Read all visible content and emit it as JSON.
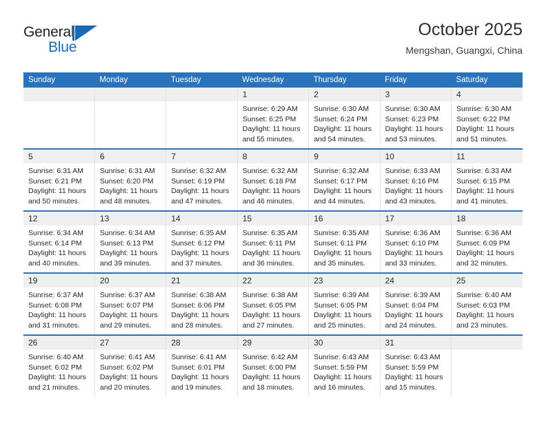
{
  "brand": {
    "name_part1": "General",
    "name_part2": "Blue",
    "flag_color": "#1c69b3",
    "logo_icon": "general-blue-flag-logo"
  },
  "header": {
    "title": "October 2025",
    "subtitle": "Mengshan, Guangxi, China",
    "accent_color": "#2a73bb"
  },
  "calendar": {
    "weekday_headers": [
      "Sunday",
      "Monday",
      "Tuesday",
      "Wednesday",
      "Thursday",
      "Friday",
      "Saturday"
    ],
    "weeks": [
      [
        {
          "day": "",
          "empty": true
        },
        {
          "day": "",
          "empty": true
        },
        {
          "day": "",
          "empty": true
        },
        {
          "day": "1",
          "sunrise": "Sunrise: 6:29 AM",
          "sunset": "Sunset: 6:25 PM",
          "daylight": "Daylight: 11 hours and 55 minutes."
        },
        {
          "day": "2",
          "sunrise": "Sunrise: 6:30 AM",
          "sunset": "Sunset: 6:24 PM",
          "daylight": "Daylight: 11 hours and 54 minutes."
        },
        {
          "day": "3",
          "sunrise": "Sunrise: 6:30 AM",
          "sunset": "Sunset: 6:23 PM",
          "daylight": "Daylight: 11 hours and 53 minutes."
        },
        {
          "day": "4",
          "sunrise": "Sunrise: 6:30 AM",
          "sunset": "Sunset: 6:22 PM",
          "daylight": "Daylight: 11 hours and 51 minutes."
        }
      ],
      [
        {
          "day": "5",
          "sunrise": "Sunrise: 6:31 AM",
          "sunset": "Sunset: 6:21 PM",
          "daylight": "Daylight: 11 hours and 50 minutes."
        },
        {
          "day": "6",
          "sunrise": "Sunrise: 6:31 AM",
          "sunset": "Sunset: 6:20 PM",
          "daylight": "Daylight: 11 hours and 48 minutes."
        },
        {
          "day": "7",
          "sunrise": "Sunrise: 6:32 AM",
          "sunset": "Sunset: 6:19 PM",
          "daylight": "Daylight: 11 hours and 47 minutes."
        },
        {
          "day": "8",
          "sunrise": "Sunrise: 6:32 AM",
          "sunset": "Sunset: 6:18 PM",
          "daylight": "Daylight: 11 hours and 46 minutes."
        },
        {
          "day": "9",
          "sunrise": "Sunrise: 6:32 AM",
          "sunset": "Sunset: 6:17 PM",
          "daylight": "Daylight: 11 hours and 44 minutes."
        },
        {
          "day": "10",
          "sunrise": "Sunrise: 6:33 AM",
          "sunset": "Sunset: 6:16 PM",
          "daylight": "Daylight: 11 hours and 43 minutes."
        },
        {
          "day": "11",
          "sunrise": "Sunrise: 6:33 AM",
          "sunset": "Sunset: 6:15 PM",
          "daylight": "Daylight: 11 hours and 41 minutes."
        }
      ],
      [
        {
          "day": "12",
          "sunrise": "Sunrise: 6:34 AM",
          "sunset": "Sunset: 6:14 PM",
          "daylight": "Daylight: 11 hours and 40 minutes."
        },
        {
          "day": "13",
          "sunrise": "Sunrise: 6:34 AM",
          "sunset": "Sunset: 6:13 PM",
          "daylight": "Daylight: 11 hours and 39 minutes."
        },
        {
          "day": "14",
          "sunrise": "Sunrise: 6:35 AM",
          "sunset": "Sunset: 6:12 PM",
          "daylight": "Daylight: 11 hours and 37 minutes."
        },
        {
          "day": "15",
          "sunrise": "Sunrise: 6:35 AM",
          "sunset": "Sunset: 6:11 PM",
          "daylight": "Daylight: 11 hours and 36 minutes."
        },
        {
          "day": "16",
          "sunrise": "Sunrise: 6:35 AM",
          "sunset": "Sunset: 6:11 PM",
          "daylight": "Daylight: 11 hours and 35 minutes."
        },
        {
          "day": "17",
          "sunrise": "Sunrise: 6:36 AM",
          "sunset": "Sunset: 6:10 PM",
          "daylight": "Daylight: 11 hours and 33 minutes."
        },
        {
          "day": "18",
          "sunrise": "Sunrise: 6:36 AM",
          "sunset": "Sunset: 6:09 PM",
          "daylight": "Daylight: 11 hours and 32 minutes."
        }
      ],
      [
        {
          "day": "19",
          "sunrise": "Sunrise: 6:37 AM",
          "sunset": "Sunset: 6:08 PM",
          "daylight": "Daylight: 11 hours and 31 minutes."
        },
        {
          "day": "20",
          "sunrise": "Sunrise: 6:37 AM",
          "sunset": "Sunset: 6:07 PM",
          "daylight": "Daylight: 11 hours and 29 minutes."
        },
        {
          "day": "21",
          "sunrise": "Sunrise: 6:38 AM",
          "sunset": "Sunset: 6:06 PM",
          "daylight": "Daylight: 11 hours and 28 minutes."
        },
        {
          "day": "22",
          "sunrise": "Sunrise: 6:38 AM",
          "sunset": "Sunset: 6:05 PM",
          "daylight": "Daylight: 11 hours and 27 minutes."
        },
        {
          "day": "23",
          "sunrise": "Sunrise: 6:39 AM",
          "sunset": "Sunset: 6:05 PM",
          "daylight": "Daylight: 11 hours and 25 minutes."
        },
        {
          "day": "24",
          "sunrise": "Sunrise: 6:39 AM",
          "sunset": "Sunset: 6:04 PM",
          "daylight": "Daylight: 11 hours and 24 minutes."
        },
        {
          "day": "25",
          "sunrise": "Sunrise: 6:40 AM",
          "sunset": "Sunset: 6:03 PM",
          "daylight": "Daylight: 11 hours and 23 minutes."
        }
      ],
      [
        {
          "day": "26",
          "sunrise": "Sunrise: 6:40 AM",
          "sunset": "Sunset: 6:02 PM",
          "daylight": "Daylight: 11 hours and 21 minutes."
        },
        {
          "day": "27",
          "sunrise": "Sunrise: 6:41 AM",
          "sunset": "Sunset: 6:02 PM",
          "daylight": "Daylight: 11 hours and 20 minutes."
        },
        {
          "day": "28",
          "sunrise": "Sunrise: 6:41 AM",
          "sunset": "Sunset: 6:01 PM",
          "daylight": "Daylight: 11 hours and 19 minutes."
        },
        {
          "day": "29",
          "sunrise": "Sunrise: 6:42 AM",
          "sunset": "Sunset: 6:00 PM",
          "daylight": "Daylight: 11 hours and 18 minutes."
        },
        {
          "day": "30",
          "sunrise": "Sunrise: 6:43 AM",
          "sunset": "Sunset: 5:59 PM",
          "daylight": "Daylight: 11 hours and 16 minutes."
        },
        {
          "day": "31",
          "sunrise": "Sunrise: 6:43 AM",
          "sunset": "Sunset: 5:59 PM",
          "daylight": "Daylight: 11 hours and 15 minutes."
        },
        {
          "day": "",
          "empty": true
        }
      ]
    ]
  }
}
